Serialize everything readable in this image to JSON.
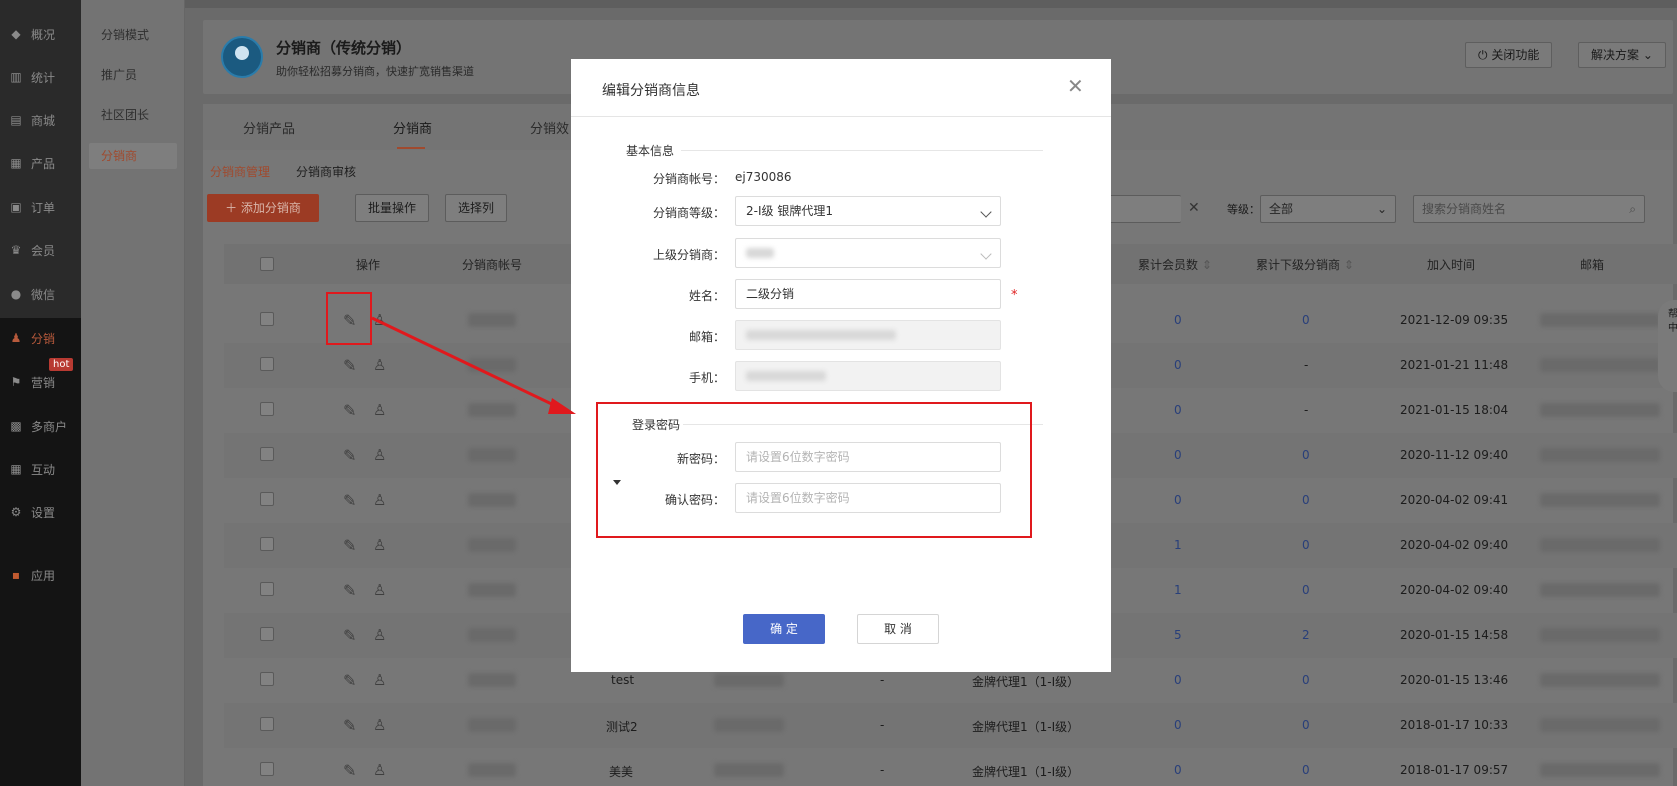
{
  "sidebar": {
    "items": [
      {
        "label": "概况",
        "icon": "layers-icon"
      },
      {
        "label": "统计",
        "icon": "chart-icon"
      },
      {
        "label": "商城",
        "icon": "store-icon"
      },
      {
        "label": "产品",
        "icon": "grid-icon"
      },
      {
        "label": "订单",
        "icon": "order-icon"
      },
      {
        "label": "会员",
        "icon": "crown-icon"
      },
      {
        "label": "微信",
        "icon": "wechat-icon"
      },
      {
        "label": "分销",
        "icon": "user-share-icon"
      },
      {
        "label": "营销",
        "icon": "flag-icon"
      },
      {
        "label": "多商户",
        "icon": "shop-icon"
      },
      {
        "label": "互动",
        "icon": "apps-icon"
      },
      {
        "label": "设置",
        "icon": "gear-icon"
      },
      {
        "label": "应用",
        "icon": "app-grid-icon"
      }
    ],
    "hot_badge": "hot"
  },
  "subnav": {
    "items": [
      "分销模式",
      "推广员",
      "社区团长",
      "分销商"
    ]
  },
  "header": {
    "title": "分销商（传统分销）",
    "subtitle": "助你轻松招募分销商，快速扩宽销售渠道",
    "close_feature": "关闭功能",
    "solutions": "解决方案"
  },
  "tabs": [
    "分销产品",
    "分销商",
    "分销效"
  ],
  "subtabs": [
    "分销商管理",
    "分销商审核"
  ],
  "toolbar": {
    "add": "添加分销商",
    "batch": "批量操作",
    "columns": "选择列",
    "level_label": "等级：",
    "level_value": "全部",
    "search_placeholder": "搜索分销商姓名"
  },
  "table": {
    "headers": [
      "操作",
      "分销商帐号",
      "累计会员数",
      "累计下级分销商",
      "加入时间",
      "邮箱"
    ],
    "rows": [
      {
        "members": "0",
        "subs": "0",
        "time": "2021-12-09 09:35",
        "name": "",
        "level": "",
        "dash": ""
      },
      {
        "members": "0",
        "subs": "-",
        "time": "2021-01-21 11:48",
        "name": "",
        "level": "",
        "dash": ""
      },
      {
        "members": "0",
        "subs": "-",
        "time": "2021-01-15 18:04",
        "name": "",
        "level": "",
        "dash": ""
      },
      {
        "members": "0",
        "subs": "0",
        "time": "2020-11-12 09:40",
        "name": "",
        "level": "",
        "dash": ""
      },
      {
        "members": "0",
        "subs": "0",
        "time": "2020-04-02 09:41",
        "name": "",
        "level": "",
        "dash": ""
      },
      {
        "members": "1",
        "subs": "0",
        "time": "2020-04-02 09:40",
        "name": "",
        "level": "",
        "dash": ""
      },
      {
        "members": "1",
        "subs": "0",
        "time": "2020-04-02 09:40",
        "name": "",
        "level": "",
        "dash": ""
      },
      {
        "members": "5",
        "subs": "2",
        "time": "2020-01-15 14:58",
        "name": "",
        "level": "",
        "dash": ""
      },
      {
        "members": "0",
        "subs": "0",
        "time": "2020-01-15 13:46",
        "name": "test",
        "level": "金牌代理1（1-I级）",
        "dash": "-"
      },
      {
        "members": "0",
        "subs": "0",
        "time": "2018-01-17 10:33",
        "name": "测试2",
        "level": "金牌代理1（1-I级）",
        "dash": "-"
      },
      {
        "members": "0",
        "subs": "0",
        "time": "2018-01-17 09:57",
        "name": "美美",
        "level": "金牌代理1（1-I级）",
        "dash": "-"
      }
    ]
  },
  "help_tab": "帮助中心",
  "modal": {
    "title": "编辑分销商信息",
    "basic_section": "基本信息",
    "account_label": "分销商帐号：",
    "account_value": "ej730086",
    "level_label": "分销商等级：",
    "level_value": "2-I级 银牌代理1",
    "parent_label": "上级分销商：",
    "name_label": "姓名：",
    "name_value": "二级分销",
    "required_mark": "*",
    "email_label": "邮箱：",
    "phone_label": "手机：",
    "password_section": "登录密码",
    "new_pwd_label": "新密码：",
    "new_pwd_placeholder": "请设置6位数字密码",
    "confirm_pwd_label": "确认密码：",
    "confirm_pwd_placeholder": "请设置6位数字密码",
    "ok": "确 定",
    "cancel": "取 消"
  },
  "colors": {
    "highlight": "#e0191d",
    "primary": "#4767c8",
    "accent": "#a04a2e"
  }
}
